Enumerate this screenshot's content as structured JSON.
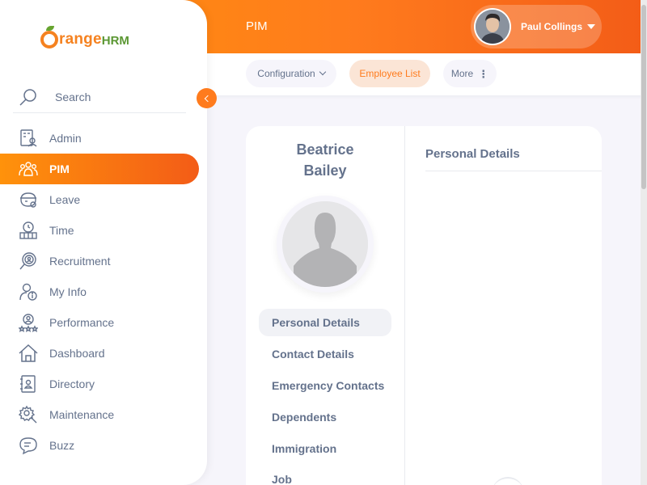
{
  "topbar": {
    "title": "PIM",
    "user": {
      "name": "Paul Collings",
      "avatar_icon": "user-avatar"
    }
  },
  "subnav": {
    "items": [
      {
        "label": "Configuration",
        "has_dropdown": true
      },
      {
        "label": "Employee List",
        "active": true
      },
      {
        "label": "More",
        "has_menu": true
      }
    ]
  },
  "sidebar": {
    "logo": {
      "part1": "range",
      "part2": "HRM"
    },
    "search_label": "Search",
    "items": [
      {
        "label": "Admin",
        "icon": "admin-icon"
      },
      {
        "label": "PIM",
        "icon": "pim-icon",
        "active": true
      },
      {
        "label": "Leave",
        "icon": "leave-icon"
      },
      {
        "label": "Time",
        "icon": "time-icon"
      },
      {
        "label": "Recruitment",
        "icon": "recruitment-icon"
      },
      {
        "label": "My Info",
        "icon": "my-info-icon"
      },
      {
        "label": "Performance",
        "icon": "performance-icon"
      },
      {
        "label": "Dashboard",
        "icon": "dashboard-icon"
      },
      {
        "label": "Directory",
        "icon": "directory-icon"
      },
      {
        "label": "Maintenance",
        "icon": "maintenance-icon"
      },
      {
        "label": "Buzz",
        "icon": "buzz-icon"
      }
    ]
  },
  "employee": {
    "first_name": "Beatrice",
    "last_name": "Bailey"
  },
  "tabs": [
    {
      "label": "Personal Details",
      "active": true
    },
    {
      "label": "Contact Details"
    },
    {
      "label": "Emergency Contacts"
    },
    {
      "label": "Dependents"
    },
    {
      "label": "Immigration"
    },
    {
      "label": "Job"
    }
  ],
  "panel": {
    "title": "Personal Details"
  },
  "colors": {
    "accent": "#ff7b1d",
    "text": "#64728c",
    "brand_green": "#5b9733"
  }
}
